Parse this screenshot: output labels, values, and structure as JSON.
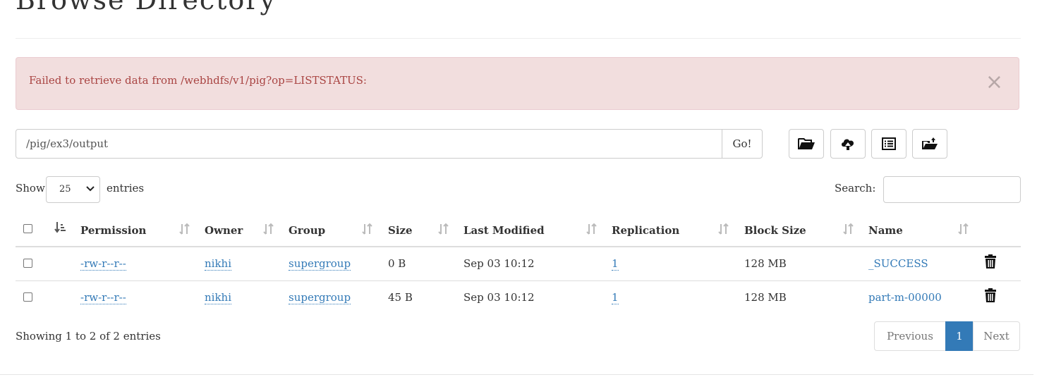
{
  "page": {
    "title": "Browse Directory"
  },
  "alert": {
    "message": "Failed to retrieve data from /webhdfs/v1/pig?op=LISTSTATUS:",
    "close_glyph": "×"
  },
  "path_bar": {
    "value": "/pig/ex3/output",
    "go_label": "Go!"
  },
  "toolbar": {
    "buttons": [
      {
        "icon": "folder-open-icon",
        "purpose": "create directory"
      },
      {
        "icon": "cloud-upload-icon",
        "purpose": "upload files"
      },
      {
        "icon": "list-alt-icon",
        "purpose": "toggle details"
      },
      {
        "icon": "folder-move-icon",
        "purpose": "cut/paste"
      }
    ]
  },
  "table_controls": {
    "show_label": "Show",
    "entries_value": "25",
    "entries_label": "entries",
    "search_label": "Search:",
    "search_value": ""
  },
  "table": {
    "columns": [
      "Permission",
      "Owner",
      "Group",
      "Size",
      "Last Modified",
      "Replication",
      "Block Size",
      "Name"
    ],
    "rows": [
      {
        "permission": "-rw-r--r--",
        "owner": "nikhi",
        "group": "supergroup",
        "size": "0 B",
        "last_modified": "Sep 03 10:12",
        "replication": "1",
        "block_size": "128 MB",
        "name": "_SUCCESS"
      },
      {
        "permission": "-rw-r--r--",
        "owner": "nikhi",
        "group": "supergroup",
        "size": "45 B",
        "last_modified": "Sep 03 10:12",
        "replication": "1",
        "block_size": "128 MB",
        "name": "part-m-00000"
      }
    ]
  },
  "footer": {
    "info": "Showing 1 to 2 of 2 entries",
    "previous_label": "Previous",
    "current_page": "1",
    "next_label": "Next"
  },
  "colors": {
    "link": "#337ab7",
    "alert_bg": "#f2dede",
    "alert_text": "#a94442",
    "active_page": "#337ab7"
  }
}
